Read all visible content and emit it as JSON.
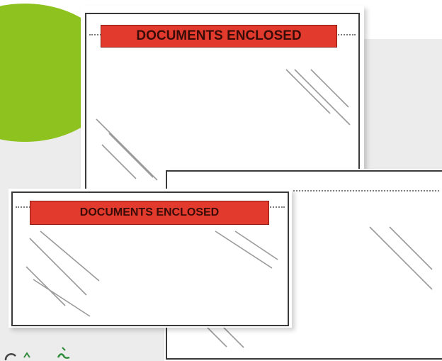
{
  "image": {
    "subject": "clear packing list pouches",
    "labels": {
      "large_pouch": "DOCUMENTS ENCLOSED",
      "small_pouch": "DOCUMENTS ENCLOSED"
    },
    "colors": {
      "label_red": "#e23b2d",
      "accent_green": "#8dc21f",
      "background_gray": "#ececec"
    }
  }
}
